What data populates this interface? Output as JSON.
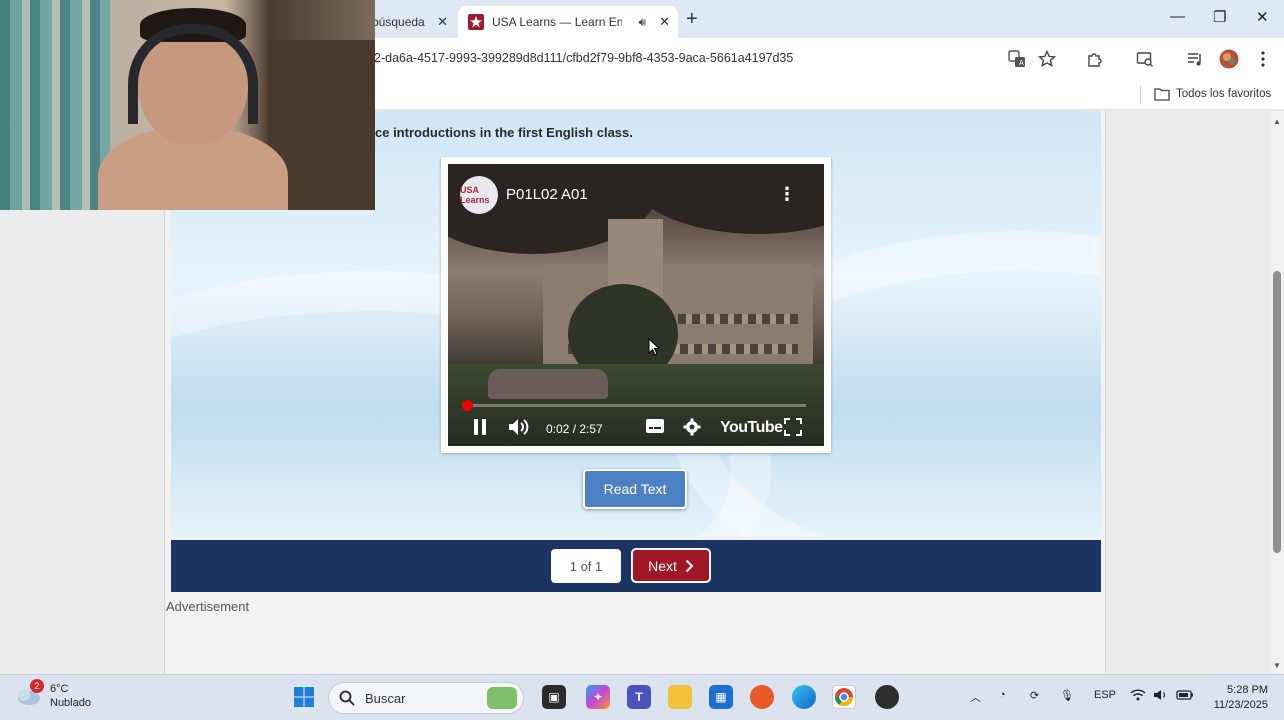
{
  "browser": {
    "tabs": [
      {
        "label": "búsqueda",
        "active": false
      },
      {
        "label": "USA Learns — Learn English",
        "active": true
      }
    ],
    "url": "2-da6a-4517-9993-399289d8d111/cfbd2f79-9bf8-4353-9aca-5661a4197d35",
    "bookmarks_folder": "Todos los favoritos"
  },
  "lesson": {
    "instruction": "ce introductions in the first English class.",
    "video": {
      "title": "P01L02 A01",
      "time": "0:02 / 2:57",
      "progress_fraction": 0.011,
      "logo_text": "USA Learns",
      "brand": "YouTube"
    },
    "read_text_label": "Read Text",
    "pager": "1 of 1",
    "next_label": "Next",
    "advertisement_label": "Advertisement"
  },
  "taskbar": {
    "weather_badge": "2",
    "temperature": "6°C",
    "condition": "Nublado",
    "search_placeholder": "Buscar",
    "language": "ESP",
    "time": "5:28 PM",
    "date": "11/23/2025"
  },
  "colors": {
    "nav_bar": "#1b3461",
    "next_button": "#a01826",
    "read_text_button": "#4c82c4",
    "video_progress": "#ee0000"
  }
}
